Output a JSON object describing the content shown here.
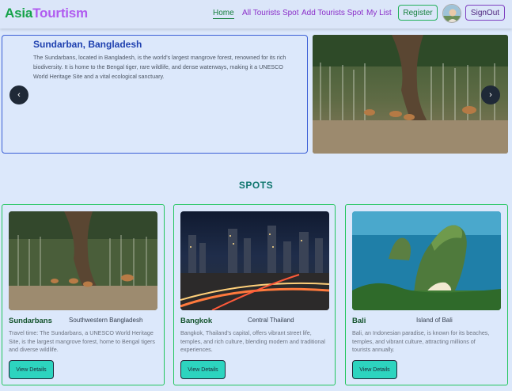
{
  "navbar": {
    "logo_part1": "Asia",
    "logo_part2": "Tourtism",
    "links": [
      "Home",
      "All Tourists Spot",
      "Add Tourists Spot",
      "My List"
    ],
    "register_label": "Register",
    "signout_label": "SignOut"
  },
  "hero": {
    "title": "Sundarban, Bangladesh",
    "description": "The Sundarbans, located in Bangladesh, is the world's largest mangrove forest, renowned for its rich biodiversity. It is home to the Bengal tiger, rare wildlife, and dense waterways, making it a UNESCO World Heritage Site and a vital ecological sanctuary.",
    "prev_arrow": "‹",
    "next_arrow": "›"
  },
  "section_title": "SPOTS",
  "cards": [
    {
      "name": "Sundarbans",
      "region": "Southwestern Bangladesh",
      "description": "Travel time: The Sundarbans, a UNESCO World Heritage Site, is the largest mangrove forest, home to Bengal tigers and diverse wildlife.",
      "button": "View Details"
    },
    {
      "name": "Bangkok",
      "region": "Central Thailand",
      "description": "Bangkok, Thailand's capital, offers vibrant street life, temples, and rich culture, blending modern and traditional experiences.",
      "button": "View Details"
    },
    {
      "name": "Bali",
      "region": "Island of Bali",
      "description": "Bali, an Indonesian paradise, is known for its beaches, temples, and vibrant culture, attracting millions of tourists annually.",
      "button": "View Details"
    }
  ],
  "colors": {
    "accent_green": "#16a34a",
    "accent_purple": "#b05cf0",
    "hero_title": "#1e40af",
    "button_teal": "#2dd4bf",
    "card_border": "#22c55e"
  }
}
